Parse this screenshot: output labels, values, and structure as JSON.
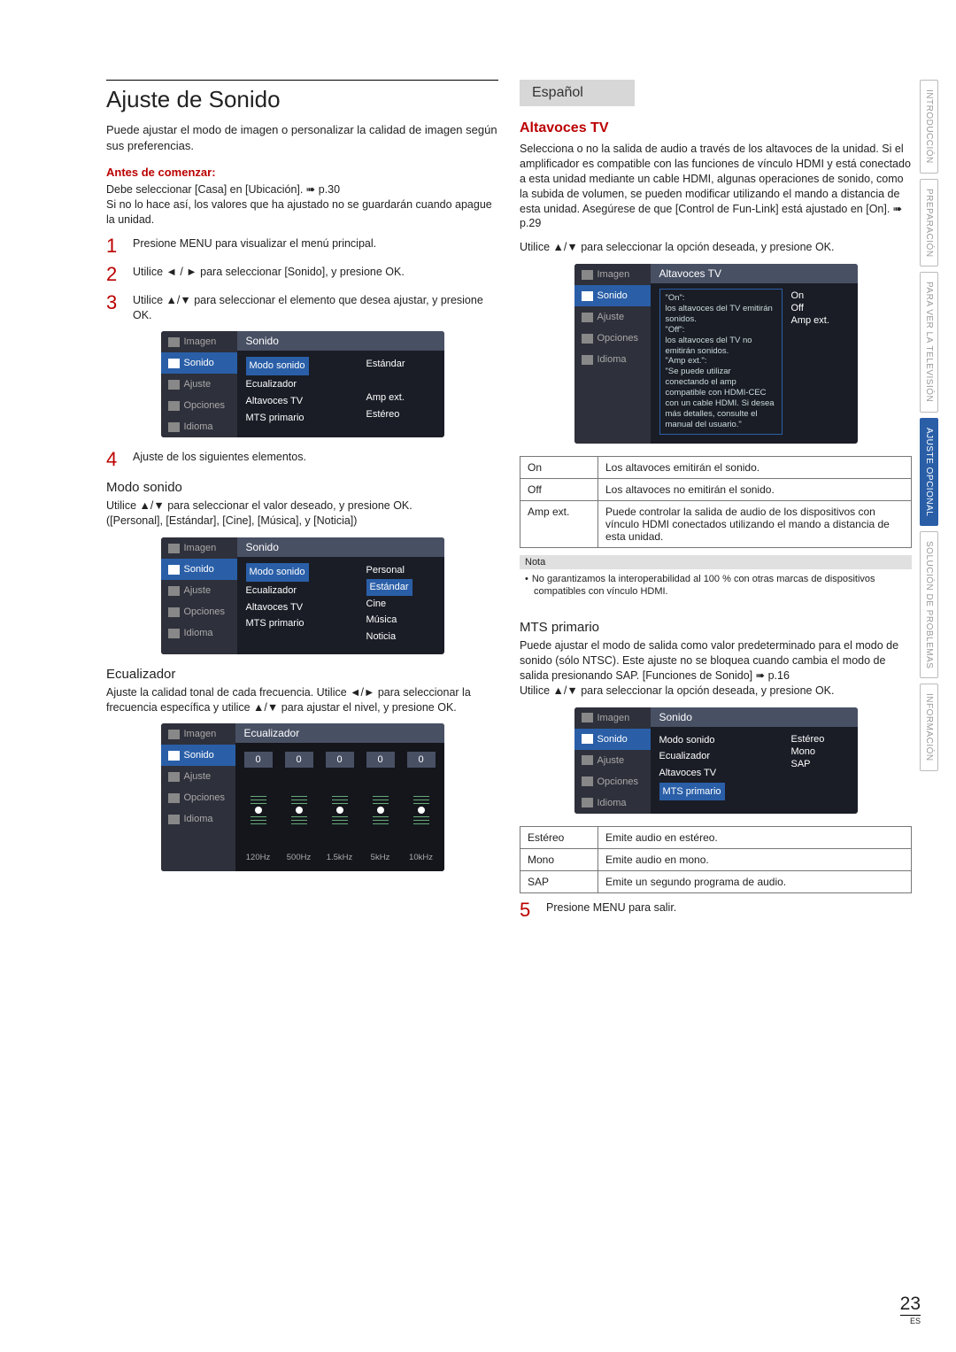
{
  "page_number": "23",
  "page_sub": "ES",
  "side_tabs": [
    "INTRODUCCIÓN",
    "PREPARACIÓN",
    "PARA VER LA TELEVISIÓN",
    "AJUSTE OPCIONAL",
    "SOLUCIÓN DE PROBLEMAS",
    "INFORMACIÓN"
  ],
  "left": {
    "title": "Ajuste de Sonido",
    "intro": "Puede ajustar el modo de imagen o personalizar la calidad de imagen según sus preferencias.",
    "before_head": "Antes de comenzar:",
    "before_body": "Debe seleccionar [Casa] en [Ubicación]. ➠ p.30\nSi no lo hace así, los valores que ha ajustado no se guardarán cuando apague la unidad.",
    "steps": {
      "s1": "Presione MENU para visualizar el menú principal.",
      "s2": "Utilice ◄ / ► para seleccionar [Sonido], y presione OK.",
      "s3": "Utilice ▲/▼ para seleccionar el elemento que desea ajustar, y presione OK.",
      "s4": "Ajuste de los siguientes elementos."
    },
    "osd1": {
      "title": "Sonido",
      "tabs": [
        "Imagen",
        "Sonido",
        "Ajuste",
        "Opciones",
        "Idioma"
      ],
      "items": [
        "Modo sonido",
        "Ecualizador",
        "Altavoces TV",
        "MTS primario"
      ],
      "vals": [
        "Estándar",
        "",
        "Amp ext.",
        "Estéreo"
      ]
    },
    "modo_head": "Modo sonido",
    "modo_body": "Utilice ▲/▼ para seleccionar el valor deseado, y presione OK.\n([Personal], [Estándar], [Cine], [Música], y [Noticia])",
    "osd2": {
      "title": "Sonido",
      "items": [
        "Modo sonido",
        "Ecualizador",
        "Altavoces TV",
        "MTS primario"
      ],
      "vals": [
        "Personal",
        "Estándar",
        "Cine",
        "Música",
        "Noticia"
      ]
    },
    "eq_head": "Ecualizador",
    "eq_body": "Ajuste la calidad tonal de cada frecuencia. Utilice ◄/► para seleccionar la frecuencia específica y utilice ▲/▼ para ajustar el nivel, y presione OK.",
    "eq_title": "Ecualizador",
    "eq_vals": [
      "0",
      "0",
      "0",
      "0",
      "0"
    ],
    "eq_freq": [
      "120Hz",
      "500Hz",
      "1.5kHz",
      "5kHz",
      "10kHz"
    ]
  },
  "right": {
    "lang": "Español",
    "alt_head": "Altavoces TV",
    "alt_body": "Selecciona o no la salida de audio a través de los altavoces de la unidad. Si el amplificador es compatible con las funciones de vínculo HDMI y está conectado a esta unidad mediante un cable HDMI, algunas operaciones de sonido, como la subida de volumen, se pueden modificar utilizando el mando a distancia de esta unidad. Asegúrese de que [Control de Fun-Link] está ajustado en [On]. ➠ p.29",
    "alt_body2": "Utilice ▲/▼ para seleccionar la opción deseada, y presione OK.",
    "osd3": {
      "title": "Altavoces TV",
      "info": "\"On\":\n  los altavoces del TV emitirán sonidos.\n\"Off\":\n  los altavoces del TV no emitirán sonidos.\n\"Amp ext.\":\n  \"Se puede utilizar conectando el amp compatible con HDMI-CEC con un cable HDMI. Si desea más detalles, consulte el manual del usuario.\"",
      "vals": [
        "On",
        "Off",
        "Amp ext."
      ]
    },
    "tbl1": {
      "r1k": "On",
      "r1v": "Los altavoces emitirán el sonido.",
      "r2k": "Off",
      "r2v": "Los altavoces no emitirán el sonido.",
      "r3k": "Amp ext.",
      "r3v": "Puede controlar la salida de audio de los dispositivos con vínculo HDMI conectados utilizando el mando a distancia de esta unidad."
    },
    "note_label": "Nota",
    "note_body": "No garantizamos la interoperabilidad al 100 % con otras marcas de dispositivos compatibles con vínculo HDMI.",
    "mts_head": "MTS primario",
    "mts_body": "Puede ajustar el modo de salida como valor predeterminado para el modo de sonido (sólo NTSC). Este ajuste no se bloquea cuando cambia el modo de salida presionando SAP. [Funciones de Sonido] ➠ p.16\nUtilice ▲/▼ para seleccionar la opción deseada, y presione OK.",
    "osd4": {
      "title": "Sonido",
      "items": [
        "Modo sonido",
        "Ecualizador",
        "Altavoces TV",
        "MTS primario"
      ],
      "vals": [
        "Estéreo",
        "Mono",
        "SAP"
      ]
    },
    "tbl2": {
      "r1k": "Estéreo",
      "r1v": "Emite audio en estéreo.",
      "r2k": "Mono",
      "r2v": "Emite audio en mono.",
      "r3k": "SAP",
      "r3v": "Emite un segundo programa de audio."
    },
    "step5": "Presione MENU para salir."
  }
}
